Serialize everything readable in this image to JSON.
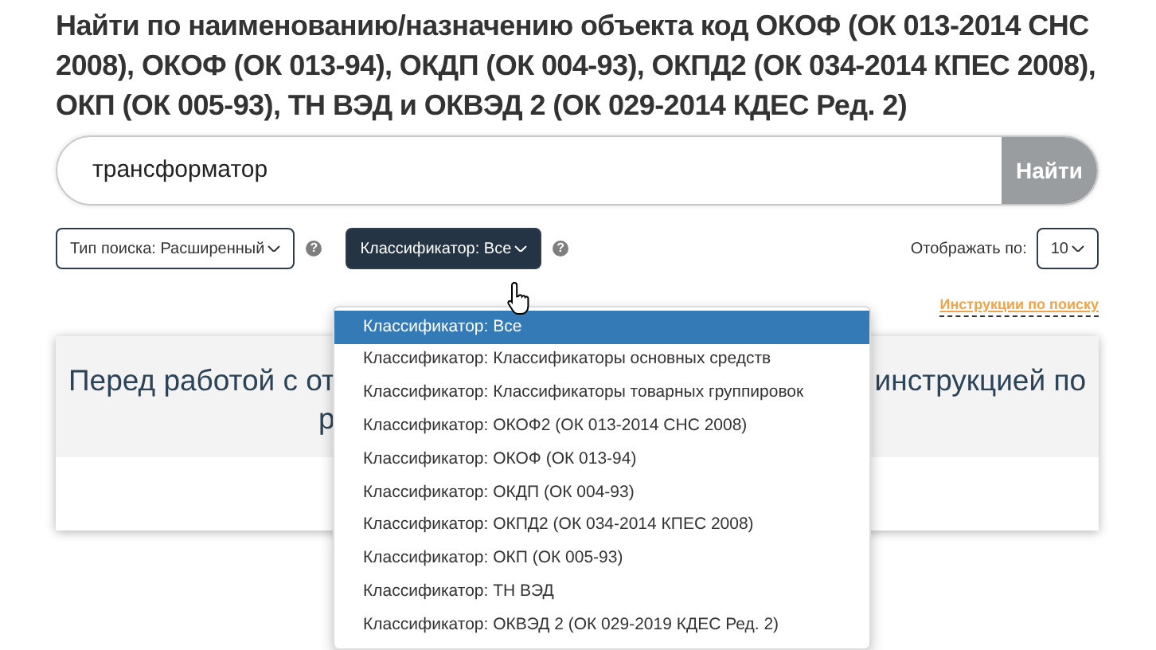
{
  "title": "Найти по наименованию/назначению объекта код ОКОФ (ОК 013-2014 СНС 2008), ОКОФ (ОК 013-94), ОКДП (ОК 004-93), ОКПД2 (ОК 034-2014 КПЕС 2008), ОКП (ОК 005-93), ТН ВЭД и ОКВЭД 2 (ОК 029-2014 КДЕС Ред. 2)",
  "search": {
    "value": "трансформатор",
    "button": "Найти"
  },
  "filters": [
    {
      "label": "Тип поиска: Расширенный",
      "help": "?",
      "expanded": false
    },
    {
      "label": "Классификатор: Все",
      "help": "?",
      "expanded": true
    }
  ],
  "per_page": {
    "label": "Отображать по:",
    "value": "10"
  },
  "instructions_link": "Инструкции по поиску",
  "banner": {
    "line_1_left": "Перед работой с от",
    "line_1_right": "инструкцией по",
    "line_2_left": "р"
  },
  "classifier_options": [
    {
      "label": "Классификатор: Все",
      "selected": true
    },
    {
      "label": "Классификатор: Классификаторы основных средств",
      "selected": false
    },
    {
      "label": "Классификатор: Классификаторы товарных группировок",
      "selected": false
    },
    {
      "label": "Классификатор: ОКОФ2 (ОК 013-2014 СНС 2008)",
      "selected": false
    },
    {
      "label": "Классификатор: ОКОФ (ОК 013-94)",
      "selected": false
    },
    {
      "label": "Классификатор: ОКДП (ОК 004-93)",
      "selected": false
    },
    {
      "label": "Классификатор: ОКПД2 (ОК 034-2014 КПЕС 2008)",
      "selected": false
    },
    {
      "label": "Классификатор: ОКП (ОК 005-93)",
      "selected": false
    },
    {
      "label": "Классификатор: ТН ВЭД",
      "selected": false
    },
    {
      "label": "Классификатор: ОКВЭД 2 (ОК 029-2019 КДЕС Ред. 2)",
      "selected": false
    }
  ]
}
